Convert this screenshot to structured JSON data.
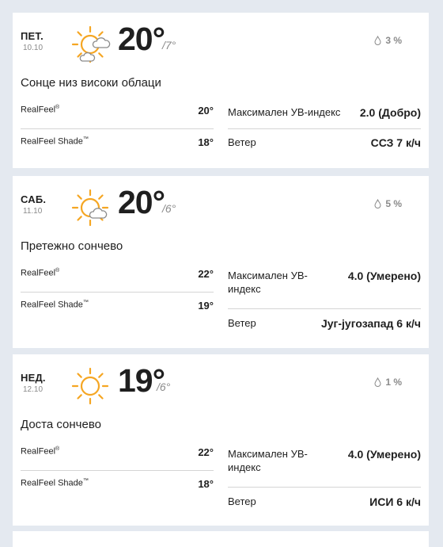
{
  "colors": {
    "sun": "#f5a623",
    "cloud": "#8a8a8a",
    "background": "#e4e9f0",
    "card": "#ffffff"
  },
  "days": [
    {
      "dow": "ПЕТ.",
      "date": "10.10",
      "icon": "sun-with-high-clouds-icon",
      "hi": "20°",
      "lo": "/7°",
      "precip": "3 %",
      "phrase": "Сонце низ високи облаци",
      "realfeel_label": "RealFeel",
      "realfeel_value": "20°",
      "realfeel_shade_label": "RealFeel Shade",
      "realfeel_shade_value": "18°",
      "uv_label": "Максимален УВ-индекс",
      "uv_value": "2.0 (Добро)",
      "wind_label": "Ветер",
      "wind_value": "ССЗ 7 к/ч"
    },
    {
      "dow": "САБ.",
      "date": "11.10",
      "icon": "mostly-sunny-icon",
      "hi": "20°",
      "lo": "/6°",
      "precip": "5 %",
      "phrase": "Претежно сончево",
      "realfeel_label": "RealFeel",
      "realfeel_value": "22°",
      "realfeel_shade_label": "RealFeel Shade",
      "realfeel_shade_value": "19°",
      "uv_label": "Максимален УВ-индекс",
      "uv_value": "4.0 (Умерено)",
      "wind_label": "Ветер",
      "wind_value": "Југ-југозапад 6 к/ч"
    },
    {
      "dow": "НЕД.",
      "date": "12.10",
      "icon": "sunny-icon",
      "hi": "19°",
      "lo": "/6°",
      "precip": "1 %",
      "phrase": "Доста сончево",
      "realfeel_label": "RealFeel",
      "realfeel_value": "22°",
      "realfeel_shade_label": "RealFeel Shade",
      "realfeel_shade_value": "18°",
      "uv_label": "Максимален УВ-индекс",
      "uv_value": "4.0 (Умерено)",
      "wind_label": "Ветер",
      "wind_value": "ИСИ 6 к/ч"
    }
  ]
}
